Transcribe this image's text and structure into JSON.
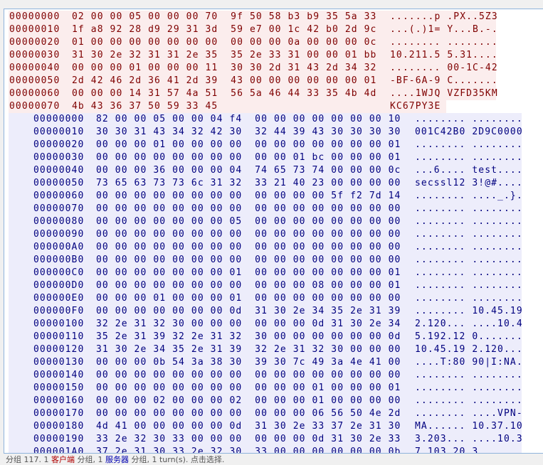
{
  "colors": {
    "client_bg": "#fbeded",
    "client_text": "#7f0000",
    "server_bg": "#ededfb",
    "server_text": "#00007f"
  },
  "client_rows": [
    {
      "offset": "00000000",
      "hex": "02 00 00 05 00 00 00 70  9f 50 58 b3 b9 35 5a 33",
      "ascii": ".......p .PX..5Z3"
    },
    {
      "offset": "00000010",
      "hex": "1f a8 92 28 d9 29 31 3d  59 e7 00 1c 42 b0 2d 9c",
      "ascii": "...(.)1= Y...B.-."
    },
    {
      "offset": "00000020",
      "hex": "01 00 00 00 00 00 00 00  00 00 00 0a 00 00 00 0c",
      "ascii": "........ ........"
    },
    {
      "offset": "00000030",
      "hex": "31 30 2e 32 31 31 2e 35  35 2e 33 31 00 00 01 bb",
      "ascii": "10.211.5 5.31...."
    },
    {
      "offset": "00000040",
      "hex": "00 00 00 01 00 00 00 11  30 30 2d 31 43 2d 34 32",
      "ascii": "........ 00-1C-42"
    },
    {
      "offset": "00000050",
      "hex": "2d 42 46 2d 36 41 2d 39  43 00 00 00 00 00 00 01",
      "ascii": "-BF-6A-9 C......."
    },
    {
      "offset": "00000060",
      "hex": "00 00 00 14 31 57 4a 51  56 5a 46 44 33 35 4b 4d",
      "ascii": "....1WJQ VZFD35KM"
    },
    {
      "offset": "00000070",
      "hex": "4b 43 36 37 50 59 33 45",
      "ascii": "KC67PY3E"
    }
  ],
  "server_rows": [
    {
      "offset": "00000000",
      "hex": "82 00 00 05 00 00 04 f4  00 00 00 00 00 00 00 10",
      "ascii": "........ ........"
    },
    {
      "offset": "00000010",
      "hex": "30 30 31 43 34 32 42 30  32 44 39 43 30 30 30 30",
      "ascii": "001C42B0 2D9C0000"
    },
    {
      "offset": "00000020",
      "hex": "00 00 00 01 00 00 00 00  00 00 00 00 00 00 00 01",
      "ascii": "........ ........"
    },
    {
      "offset": "00000030",
      "hex": "00 00 00 00 00 00 00 00  00 00 01 bc 00 00 00 01",
      "ascii": "........ ........"
    },
    {
      "offset": "00000040",
      "hex": "00 00 00 36 00 00 00 04  74 65 73 74 00 00 00 0c",
      "ascii": "...6.... test...."
    },
    {
      "offset": "00000050",
      "hex": "73 65 63 73 73 6c 31 32  33 21 40 23 00 00 00 00",
      "ascii": "secssl12 3!@#...."
    },
    {
      "offset": "00000060",
      "hex": "00 00 00 00 00 00 00 00  00 00 00 00 5f f2 7d 14",
      "ascii": "........ ...._.}."
    },
    {
      "offset": "00000070",
      "hex": "00 00 00 00 00 00 00 00  00 00 00 00 00 00 00 00",
      "ascii": "........ ........"
    },
    {
      "offset": "00000080",
      "hex": "00 00 00 00 00 00 00 05  00 00 00 00 00 00 00 00",
      "ascii": "........ ........"
    },
    {
      "offset": "00000090",
      "hex": "00 00 00 00 00 00 00 00  00 00 00 00 00 00 00 00",
      "ascii": "........ ........"
    },
    {
      "offset": "000000A0",
      "hex": "00 00 00 00 00 00 00 00  00 00 00 00 00 00 00 00",
      "ascii": "........ ........"
    },
    {
      "offset": "000000B0",
      "hex": "00 00 00 00 00 00 00 00  00 00 00 00 00 00 00 00",
      "ascii": "........ ........"
    },
    {
      "offset": "000000C0",
      "hex": "00 00 00 00 00 00 00 01  00 00 00 00 00 00 00 01",
      "ascii": "........ ........"
    },
    {
      "offset": "000000D0",
      "hex": "00 00 00 00 00 00 00 00  00 00 00 08 00 00 00 01",
      "ascii": "........ ........"
    },
    {
      "offset": "000000E0",
      "hex": "00 00 00 01 00 00 00 01  00 00 00 00 00 00 00 00",
      "ascii": "........ ........"
    },
    {
      "offset": "000000F0",
      "hex": "00 00 00 00 00 00 00 0d  31 30 2e 34 35 2e 31 39",
      "ascii": "........ 10.45.19"
    },
    {
      "offset": "00000100",
      "hex": "32 2e 31 32 30 00 00 00  00 00 00 0d 31 30 2e 34",
      "ascii": "2.120... ....10.4"
    },
    {
      "offset": "00000110",
      "hex": "35 2e 31 39 32 2e 31 32  30 00 00 00 00 00 00 0d",
      "ascii": "5.192.12 0......."
    },
    {
      "offset": "00000120",
      "hex": "31 30 2e 34 35 2e 31 39  32 2e 31 32 30 00 00 00",
      "ascii": "10.45.19 2.120..."
    },
    {
      "offset": "00000130",
      "hex": "00 00 00 0b 54 3a 38 30  39 30 7c 49 3a 4e 41 00",
      "ascii": "....T:80 90|I:NA."
    },
    {
      "offset": "00000140",
      "hex": "00 00 00 00 00 00 00 00  00 00 00 00 00 00 00 00",
      "ascii": "........ ........"
    },
    {
      "offset": "00000150",
      "hex": "00 00 00 00 00 00 00 00  00 00 00 01 00 00 00 01",
      "ascii": "........ ........"
    },
    {
      "offset": "00000160",
      "hex": "00 00 00 02 00 00 00 02  00 00 00 01 00 00 00 00",
      "ascii": "........ ........"
    },
    {
      "offset": "00000170",
      "hex": "00 00 00 00 00 00 00 00  00 00 00 06 56 50 4e 2d",
      "ascii": "........ ....VPN-"
    },
    {
      "offset": "00000180",
      "hex": "4d 41 00 00 00 00 00 0d  31 30 2e 33 37 2e 31 30",
      "ascii": "MA...... 10.37.10"
    },
    {
      "offset": "00000190",
      "hex": "33 2e 32 30 33 00 00 00  00 00 00 0d 31 30 2e 33",
      "ascii": "3.203... ....10.3"
    },
    {
      "offset": "000001A0",
      "hex": "37 2e 31 30 33 2e 32 30  33 00 00 00 00 00 00 0b",
      "ascii": "7.103.20 3......."
    }
  ],
  "status": {
    "prefix": "分组 117. 1 ",
    "client": "客户端",
    "mid": " 分组, 1 ",
    "server": "服务器",
    "suffix": " 分组, 1 turn(s). 点击选择."
  }
}
